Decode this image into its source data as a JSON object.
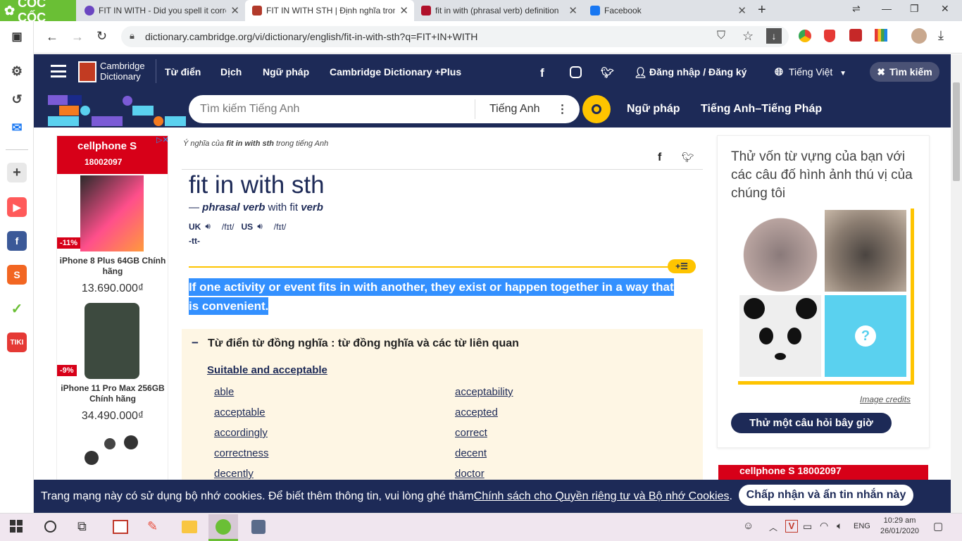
{
  "browser": {
    "brand": "CỐC CỐC",
    "tabs": [
      {
        "title": "FIT IN WITH - Did you spell it corre"
      },
      {
        "title": "FIT IN WITH STH | Định nghĩa trong"
      },
      {
        "title": "fit in with (phrasal verb) definition"
      },
      {
        "title": "Facebook"
      }
    ],
    "url": "dictionary.cambridge.org/vi/dictionary/english/fit-in-with-sth?q=FIT+IN+WITH"
  },
  "site": {
    "logo_line1": "Cambridge",
    "logo_line2": "Dictionary",
    "nav": [
      "Từ điển",
      "Dịch",
      "Ngữ pháp",
      "Cambridge Dictionary +Plus"
    ],
    "login": "Đăng nhập / Đăng ký",
    "language": "Tiếng Việt",
    "search_toggle": "Tìm kiếm",
    "search_placeholder": "Tìm kiếm Tiếng Anh",
    "search_lang": "Tiếng Anh",
    "nav2": [
      "Ngữ pháp",
      "Tiếng Anh–Tiếng Pháp"
    ]
  },
  "entry": {
    "breadcrumb_pre": "Ý nghĩa của ",
    "breadcrumb_word": "fit in with sth",
    "breadcrumb_post": " trong tiếng Anh",
    "headword": "fit in with sth",
    "pos_dash": "— ",
    "pos": "phrasal verb",
    "pos_with": " with fit ",
    "pos_verb": "verb",
    "uk": "UK",
    "uk_ipa": "/fɪt/",
    "us": "US",
    "us_ipa": "/fɪt/",
    "grammar": "-tt-",
    "definition": "If one activity or event fits in with another, they exist or happen together in a way that is convenient.",
    "thesaurus_title": "Từ điển từ đồng nghĩa : từ đồng nghĩa và các từ liên quan",
    "thesaurus_group": "Suitable and acceptable",
    "synonyms_left": [
      "able",
      "acceptable",
      "accordingly",
      "correctness",
      "decently"
    ],
    "synonyms_right": [
      "acceptability",
      "accepted",
      "correct",
      "decent",
      "doctor"
    ]
  },
  "ad_left": {
    "brand": "cellphone S",
    "phone": "18002097",
    "items": [
      {
        "badge": "-11%",
        "name": "iPhone 8 Plus 64GB Chính hãng",
        "price": "13.690.000₫"
      },
      {
        "badge": "-9%",
        "name": "iPhone 11 Pro Max 256GB Chính hãng",
        "price": "34.490.000₫"
      }
    ]
  },
  "quiz": {
    "title": "Thử vốn từ vựng của bạn với các câu đố hình ảnh thú vị của chúng tôi",
    "credits": "Image credits",
    "button": "Thử một câu hỏi bây giờ"
  },
  "ad_right_brand": "cellphone S  18002097",
  "cookie": {
    "text_pre": "Trang mạng này có sử dụng bộ nhớ cookies. Để biết thêm thông tin, vui lòng ghé thăm ",
    "link": "Chính sách cho Quyền riêng tư và Bộ nhớ Cookies",
    "text_post": ".",
    "button": "Chấp nhận và ẩn tin nhắn này"
  },
  "taskbar": {
    "lang": "ENG",
    "time": "10:29 am",
    "date": "26/01/2020"
  },
  "colors": {
    "cambridge_navy": "#1d2a57",
    "accent_yellow": "#fec400",
    "selection": "#3390ff",
    "coccoc_green": "#6abf35"
  }
}
